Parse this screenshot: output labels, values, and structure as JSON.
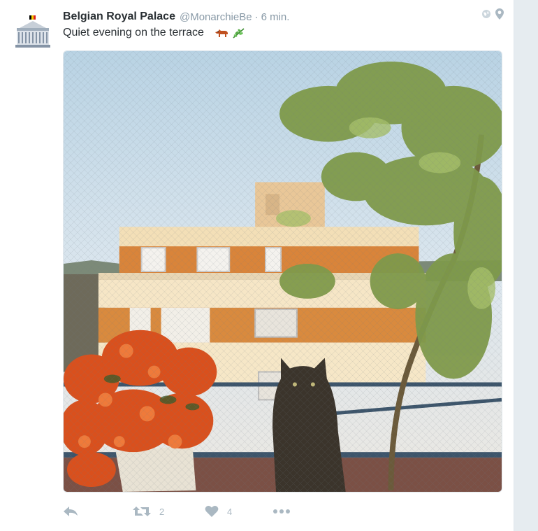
{
  "tweet": {
    "display_name": "Belgian Royal Palace",
    "screen_name": "@MonarchieBe",
    "separator": "·",
    "time": "6 min.",
    "text": "Quiet evening on the terrace",
    "emojis": [
      "dog-emoji",
      "herb-emoji"
    ],
    "avatar_icon": "royal-palace-logo",
    "photo_description_icon": "terrace-photo"
  },
  "actions": {
    "reply_icon": "reply-icon",
    "retweet_icon": "retweet-icon",
    "retweet_count": "2",
    "like_icon": "heart-icon",
    "like_count": "4",
    "more_icon": "more-icon"
  },
  "header_icons": [
    "globe-icon",
    "location-pin-icon"
  ],
  "colors": {
    "name": "#292f33",
    "muted": "#8899a6",
    "action": "#aab8c2",
    "background": "#e6ecf0"
  }
}
